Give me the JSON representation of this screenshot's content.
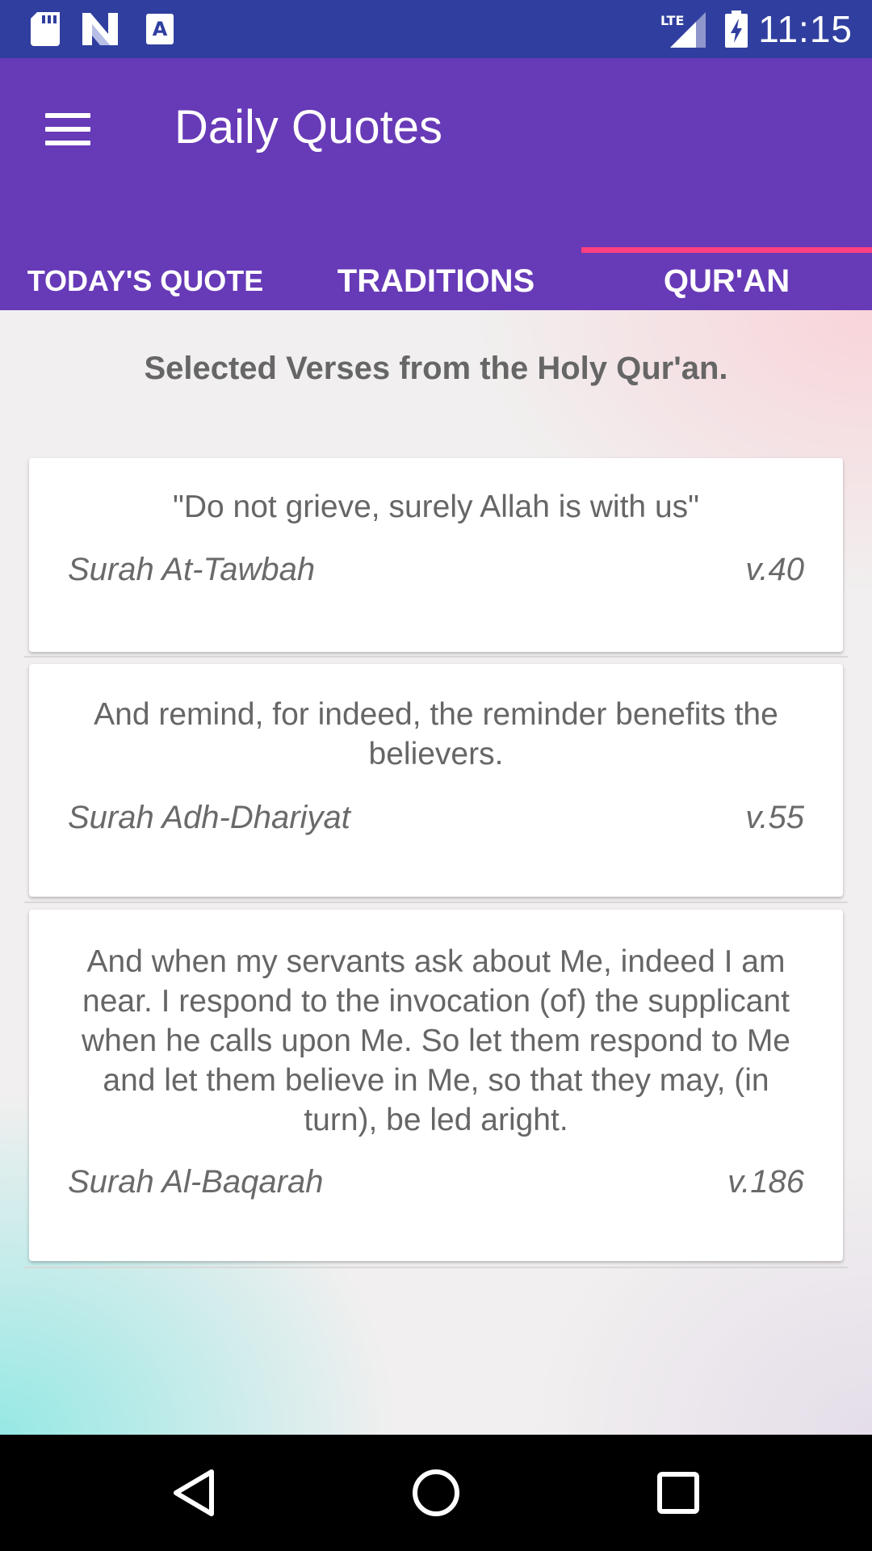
{
  "status_bar": {
    "time": "11:15",
    "left_icons": [
      "sd-card-icon",
      "n-logo-icon",
      "text-a-icon"
    ],
    "right_icons": [
      "lte-signal-icon",
      "battery-charging-icon"
    ]
  },
  "app_bar": {
    "title": "Daily Quotes",
    "menu_icon": "hamburger-menu-icon"
  },
  "tabs": [
    {
      "label": "TODAY'S QUOTE",
      "selected": false
    },
    {
      "label": "TRADITIONS",
      "selected": false
    },
    {
      "label": "QUR'AN",
      "selected": true
    }
  ],
  "colors": {
    "status_bar": "#303F9F",
    "app_bar": "#673AB7",
    "tab_indicator": "#FF4081"
  },
  "content": {
    "subtitle": "Selected Verses from the Holy Qur'an.",
    "verses": [
      {
        "quote": "\"Do not grieve, surely Allah is with us\"",
        "surah": "Surah At-Tawbah",
        "verse": "v.40"
      },
      {
        "quote": "And remind, for indeed, the reminder benefits the believers.",
        "surah": "Surah Adh-Dhariyat",
        "verse": "v.55"
      },
      {
        "quote": "And when my servants ask about Me, indeed I am near. I respond to the invocation (of) the supplicant when he calls upon Me. So let them respond to Me and let them believe in Me, so that they may, (in turn), be led aright.",
        "surah": "Surah Al-Baqarah",
        "verse": "v.186"
      }
    ]
  },
  "nav_bar": {
    "icons": [
      "back-icon",
      "home-icon",
      "recents-icon"
    ]
  }
}
